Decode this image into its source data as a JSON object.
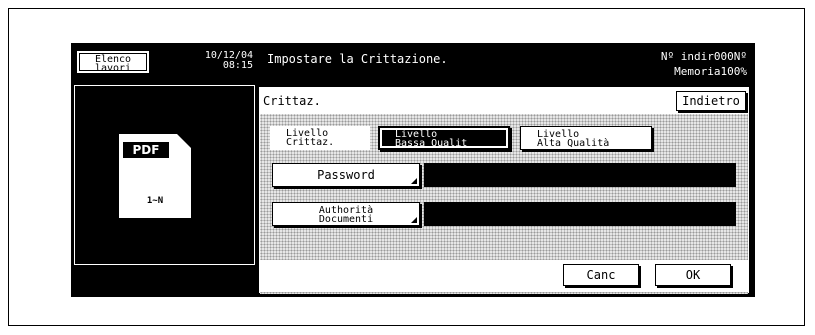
{
  "header": {
    "jobs_button": "Elenco\nlavori",
    "date": "10/12/04",
    "time": "08:15",
    "title": "Impostare la Crittazione.",
    "counter": "Nº indir000Nº",
    "memory": "Memoria100%"
  },
  "left_panel": {
    "file_type": "PDF",
    "pages": "1~N"
  },
  "main": {
    "section_label": "Crittaz.",
    "back_button": "Indietro",
    "level_label": "Livello\nCrittaz.",
    "level_low": "Livello\nBassa Qualit",
    "level_high": "Livello\nAlta Qualità",
    "selected_level": "level_low",
    "password_button": "Password",
    "password_value": "",
    "authority_button": "Authorità\nDocumenti",
    "authority_value": "",
    "cancel_button": "Canc",
    "ok_button": "OK"
  }
}
